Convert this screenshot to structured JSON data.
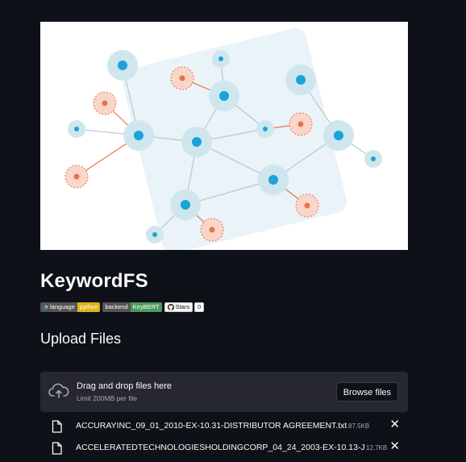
{
  "app": {
    "title": "KeywordFS",
    "hero_image": "network-graph-illustration",
    "badges": [
      {
        "icon": "python-icon",
        "label": "language",
        "value": "python",
        "color": "#dfb317"
      },
      {
        "label": "backend",
        "value": "KeyBERT",
        "color": "#4c9a5f"
      }
    ],
    "github": {
      "icon": "github-icon",
      "label": "Stars",
      "count": "0"
    }
  },
  "upload": {
    "section_title": "Upload Files",
    "dropzone_icon": "cloud-upload-icon",
    "dropzone_text": "Drag and drop files here",
    "dropzone_limit": "Limit 200MB per file",
    "browse_label": "Browse files",
    "files": [
      {
        "icon": "file-icon",
        "name": "ACCURAYINC_09_01_2010-EX-10.31-DISTRIBUTOR AGREEMENT.txt",
        "size": "87.5KB"
      },
      {
        "icon": "file-icon",
        "name": "ACCELERATEDTECHNOLOGIESHOLDINGCORP_04_24_2003-EX-10.13-J...",
        "size": "12.7KB"
      }
    ]
  },
  "colors": {
    "background": "#0e1117",
    "dropzone": "#262730",
    "node_blue": "#1aa3d6",
    "node_orange": "#e8734a",
    "halo_blue": "#cfe6ee",
    "halo_orange": "#f9d6c8"
  }
}
